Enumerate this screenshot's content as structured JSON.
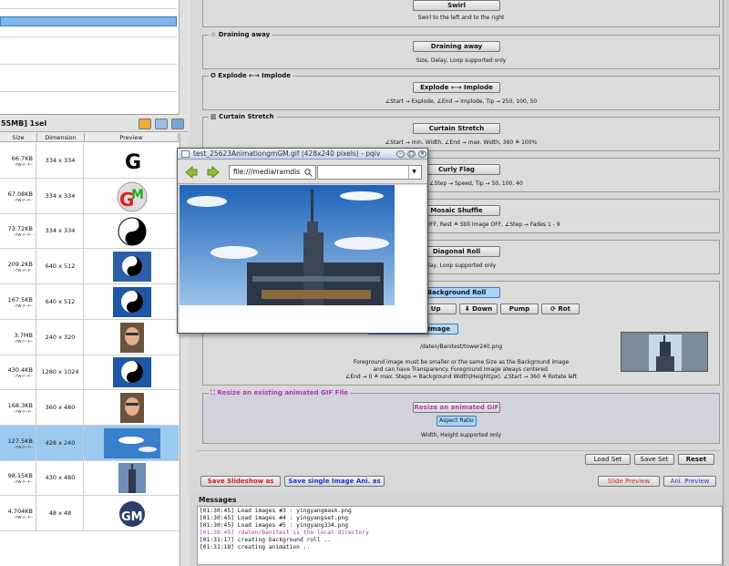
{
  "left_panel": {
    "status_text": "55MB] 1sel",
    "columns": [
      "Size",
      "Dimension",
      "Preview"
    ],
    "rows": [
      {
        "size": "66.7KB",
        "perm": "-rw-r--r--",
        "dim": "334 x 334",
        "thumb": "G"
      },
      {
        "size": "67.08KB",
        "perm": "-rw-r--r--",
        "dim": "334 x 334",
        "thumb": "GM"
      },
      {
        "size": "73.72KB",
        "perm": "-rw-r--r--",
        "dim": "334 x 334",
        "thumb": "yin-yang"
      },
      {
        "size": "209.2KB",
        "perm": "-rw-r--r--",
        "dim": "640 x 512",
        "thumb": "yin-yang-framed"
      },
      {
        "size": "167.5KB",
        "perm": "-rw-r--r--",
        "dim": "640 x 512",
        "thumb": "yin-yang-blue"
      },
      {
        "size": "3.7MB",
        "perm": "-rw-r--r--",
        "dim": "240 x 320",
        "thumb": "face"
      },
      {
        "size": "430.4KB",
        "perm": "-rw-r--r--",
        "dim": "1280 x 1024",
        "thumb": "yin-yang-blue"
      },
      {
        "size": "168.3KB",
        "perm": "-rw-r--r--",
        "dim": "360 x 480",
        "thumb": "face"
      },
      {
        "size": "127.5KB",
        "perm": "-rw-r--r--",
        "dim": "428 x 240",
        "thumb": "sky",
        "selected": true
      },
      {
        "size": "98.15KB",
        "perm": "-rw-r--r--",
        "dim": "430 x 480",
        "thumb": "tower"
      },
      {
        "size": "4.704KB",
        "perm": "-rw-r--r--",
        "dim": "48 x 48",
        "thumb": "GM-small"
      }
    ]
  },
  "sections": {
    "swirl": {
      "button": "Swirl",
      "info": "Swirl to the left and to the right"
    },
    "draining": {
      "title": "☆ Draining away",
      "button": "Draining away",
      "info": "Size, Delay, Loop supported only"
    },
    "explode": {
      "title": "✪ Explode ←→ Implode",
      "button": "Explode ←→ Implode",
      "info": "∠Start → Explode, ∠End → Implode, Tip → 250, 100, 50"
    },
    "curtain": {
      "title": "▥ Curtain Stretch",
      "button": "Curtain Stretch",
      "info": "∠Start → min. Width, ∠End → max. Width, 360 ≙ 100%"
    },
    "curly": {
      "button": "Curly Flag",
      "info": "nd → Period, ∠Step → Speed, Tip → 50, 100, 40"
    },
    "mosaic": {
      "button": "Mosaic Shuffle",
      "info": "ip ON: 0 ≙ Shuffle OFF, Rest ≙ Still Image OFF, ∠Step → Fades 1 - 9"
    },
    "diagonal": {
      "button": "Diagonal Roll",
      "info": "Delay, Loop supported only"
    },
    "bgroll": {
      "button": "Background Roll",
      "dir_buttons": [
        "⬆ Up",
        "⬇ Down",
        "Pump",
        "⟳ Rot"
      ],
      "image_button": "Image",
      "path": "/daten/Banitest/tower240.png",
      "info1": "Foreground image must be smaller or the same Size as the Background image",
      "info2": "and can have Transparency. Foreground Image always centered.",
      "info3": "∠End → 0 ≙ max. Steps = Background Width|Height(px). ∠Start → 360 ≙ Rotate left"
    },
    "resize": {
      "title": "⛶ Resize an existing animated GIF File",
      "button": "Resize an animated GIF",
      "aspect": "Aspect Ratio",
      "info": "Width, Height supported only"
    }
  },
  "bottom": {
    "load": "Load Set",
    "save": "Save Set",
    "reset": "Reset",
    "save_slideshow": "Save Slideshow as",
    "save_single": "Save single Image Ani. as",
    "slide_preview": "Slide Preview",
    "ani_preview": "Ani. Preview"
  },
  "messages": {
    "title": "Messages",
    "lines": [
      "[01:30:45] Load images #3 : yingyangmask.png",
      "[01:30:45] Load images #4 : yingyangset.png",
      "[01:30:45] Load images #5 : yingyang334.png",
      "[01:30:45] /daten/Banitest is the local directory",
      "[01:31:17] creating background roll ..",
      "[01:31:18] creating animation .."
    ]
  },
  "popup": {
    "title": "test_25623AnimationgmGM.gif (428x240 pixels) - pqiv",
    "url": "file:///media/ramdis"
  },
  "colors": {
    "selection": "#9cc9ef",
    "red_text": "#d42020",
    "blue_text": "#2233cc",
    "pink_text": "#b03ab0"
  }
}
